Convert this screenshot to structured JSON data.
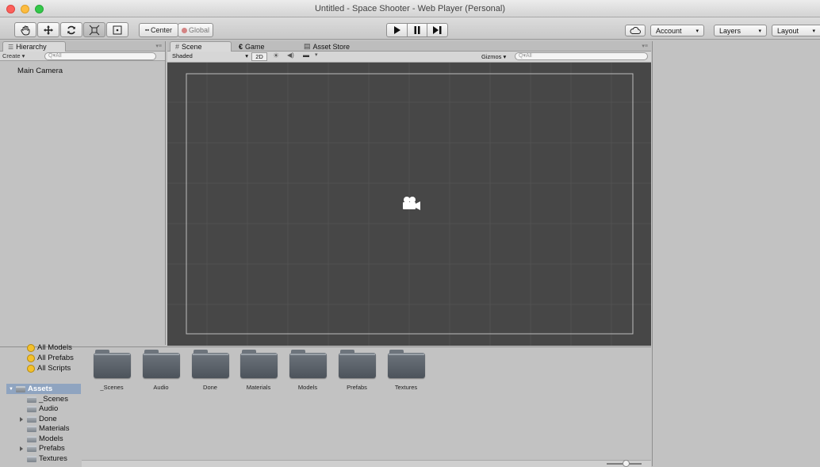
{
  "window": {
    "title": "Untitled - Space Shooter - Web Player (Personal)"
  },
  "toolbar": {
    "pivot_label": "Center",
    "space_label": "Global",
    "account_label": "Account",
    "layers_label": "Layers",
    "layout_label": "Layout"
  },
  "hierarchy": {
    "tab_label": "Hierarchy",
    "create_label": "Create",
    "search_placeholder": "Q▾All",
    "items": [
      "Main Camera"
    ]
  },
  "scene": {
    "tabs": [
      {
        "label": "Scene",
        "icon": "grid-icon"
      },
      {
        "label": "Game",
        "icon": "pacman-icon"
      },
      {
        "label": "Asset Store",
        "icon": "store-icon"
      }
    ],
    "shading_mode": "Shaded",
    "mode_2d": "2D",
    "gizmos_label": "Gizmos",
    "search_placeholder": "Q▾All"
  },
  "project": {
    "favorites": [
      "All Models",
      "All Prefabs",
      "All Scripts"
    ],
    "assets_label": "Assets",
    "tree": [
      "_Scenes",
      "Audio",
      "Done",
      "Materials",
      "Models",
      "Prefabs",
      "Textures"
    ],
    "folders": [
      "_Scenes",
      "Audio",
      "Done",
      "Materials",
      "Models",
      "Prefabs",
      "Textures"
    ]
  },
  "colors": {
    "viewport_bg": "#474747",
    "panel_bg": "#c2c2c2",
    "selection_blue": "#8fa4c0",
    "traffic_red": "#fc605b",
    "traffic_yellow": "#fdbc40",
    "traffic_green": "#34c84a"
  }
}
